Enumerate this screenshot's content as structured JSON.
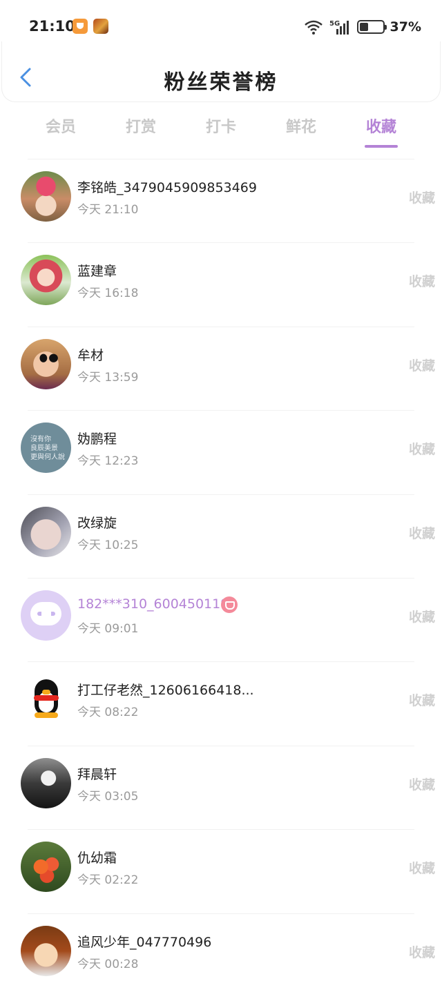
{
  "status_bar": {
    "time": "21:10",
    "network": "5G",
    "wifi_tag": "6",
    "battery_percent": "37%",
    "battery_level": 0.37,
    "icons": [
      "calendar-app-icon",
      "game-app-icon",
      "wifi-icon",
      "cellular-signal-icon",
      "battery-icon"
    ]
  },
  "header": {
    "title": "粉丝荣誉榜",
    "back_icon": "chevron-left-icon"
  },
  "tabs": [
    {
      "label": "会员",
      "active": false
    },
    {
      "label": "打赏",
      "active": false
    },
    {
      "label": "打卡",
      "active": false
    },
    {
      "label": "鲜花",
      "active": false
    },
    {
      "label": "收藏",
      "active": true
    }
  ],
  "colors": {
    "accent": "#b483d6",
    "inactive_tab": "#c8c8c8",
    "action_text": "#d0d0d0",
    "secondary_text": "#9a9a9a",
    "vip_badge": "#f48a9a"
  },
  "fans": [
    {
      "name": "李铭皓_3479045909853469",
      "date": "今天 21:10",
      "action": "收藏"
    },
    {
      "name": "蓝建章",
      "date": "今天 16:18",
      "action": "收藏"
    },
    {
      "name": "牟材",
      "date": "今天 13:59",
      "action": "收藏"
    },
    {
      "name": "妫鹏程",
      "date": "今天 12:23",
      "action": "收藏",
      "avatar_text": "沒有你\n良辰美景\n更與何人說"
    },
    {
      "name": "改绿旋",
      "date": "今天 10:25",
      "action": "收藏"
    },
    {
      "name": "182***310_6004501192",
      "date": "今天 09:01",
      "action": "收藏",
      "vip": true
    },
    {
      "name": "打工仔老然_12606166418...",
      "date": "今天 08:22",
      "action": "收藏"
    },
    {
      "name": "拜晨轩",
      "date": "今天 03:05",
      "action": "收藏"
    },
    {
      "name": "仇幼霜",
      "date": "今天 02:22",
      "action": "收藏"
    },
    {
      "name": "追风少年_047770496",
      "date": "今天 00:28",
      "action": "收藏"
    }
  ]
}
